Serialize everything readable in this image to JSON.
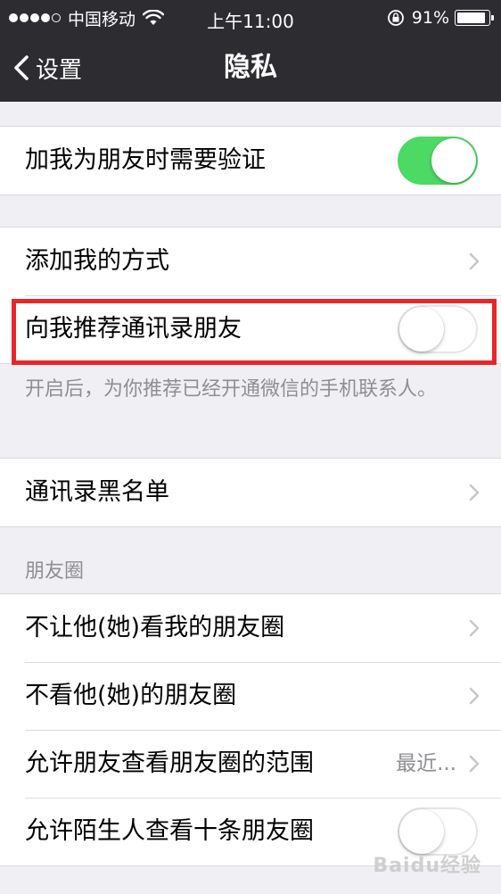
{
  "status_bar": {
    "carrier": "中国移动",
    "time": "上午11:00",
    "battery_pct": "91%",
    "battery_level": 0.91
  },
  "nav": {
    "back_label": "设置",
    "title": "隐私"
  },
  "groups": {
    "verify": {
      "label": "加我为朋友时需要验证",
      "switch_on": true
    },
    "add_methods": {
      "label": "添加我的方式"
    },
    "recommend_contacts": {
      "label": "向我推荐通讯录朋友",
      "switch_on": false,
      "footnote": "开启后，为你推荐已经开通微信的手机联系人。"
    },
    "blacklist": {
      "label": "通讯录黑名单"
    },
    "moments": {
      "section_title": "朋友圈",
      "items": [
        {
          "label": "不让他(她)看我的朋友圈"
        },
        {
          "label": "不看他(她)的朋友圈"
        },
        {
          "label": "允许朋友查看朋友圈的范围",
          "value": "最近..."
        },
        {
          "label": "允许陌生人查看十条朋友圈",
          "switch_on": false
        }
      ]
    }
  },
  "watermark": "Baidu经验",
  "colors": {
    "nav_bg": "#2c2c31",
    "switch_on": "#4cd964",
    "highlight": "#e8262a"
  }
}
